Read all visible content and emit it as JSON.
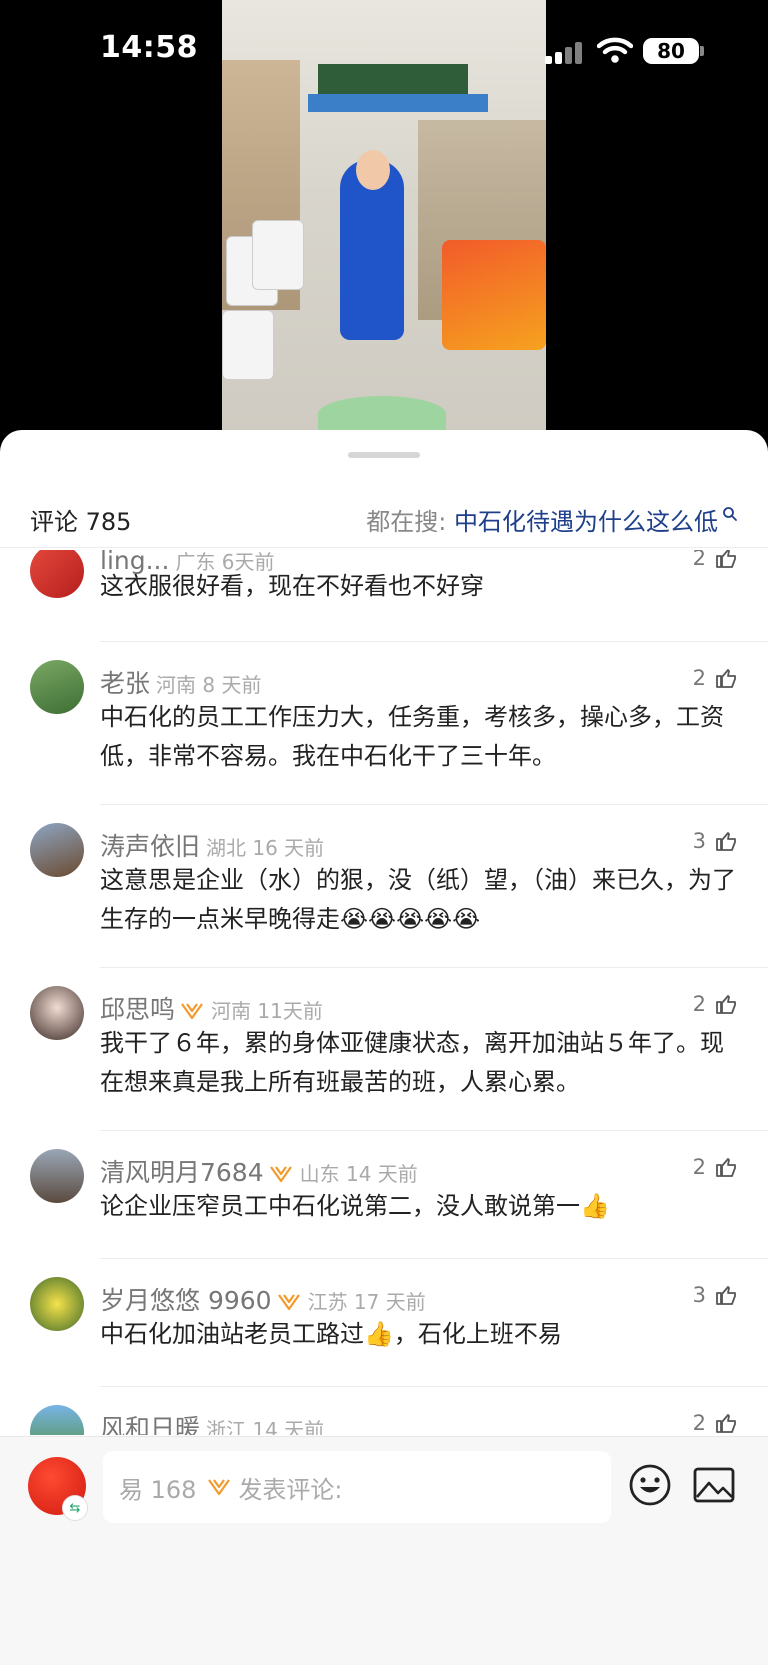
{
  "status_bar": {
    "time": "14:58",
    "battery": "80"
  },
  "header": {
    "comments_label": "评论 785",
    "search_prefix": "都在搜:",
    "search_keyword": "中石化待遇为什么这么低"
  },
  "comments": [
    {
      "name": "ling...",
      "meta": "广东 6天前",
      "likes": "2",
      "text": "这衣服很好看，现在不好看也不好穿"
    },
    {
      "name": "老张",
      "meta": "河南 8 天前",
      "likes": "2",
      "text": "中石化的员工工作压力大，任务重，考核多，操心多，工资低，非常不容易。我在中石化干了三十年。"
    },
    {
      "name": "涛声依旧",
      "meta": "湖北 16 天前",
      "likes": "3",
      "text": "这意思是企业（水）的狠，没（纸）望，（油）来已久，为了生存的一点米早晚得走😭😭😭😭😭"
    },
    {
      "name": "邱思鸣",
      "meta": "河南 11天前",
      "likes": "2",
      "text": "我干了６年，累的身体亚健康状态，离开加油站５年了。现在想来真是我上所有班最苦的班，人累心累。"
    },
    {
      "name": "清风明月7684",
      "meta": "山东 14 天前",
      "likes": "2",
      "text": "论企业压窄员工中石化说第二，没人敢说第一👍"
    },
    {
      "name": "岁月悠悠 9960",
      "meta": "江苏 17 天前",
      "likes": "3",
      "text": "中石化加油站老员工路过👍，石化上班不易"
    },
    {
      "name": "风和日暖",
      "meta": "浙江 14 天前",
      "likes": "2",
      "text": ""
    }
  ],
  "input_bar": {
    "user": "易 168",
    "placeholder": "发表评论:"
  },
  "colors": {
    "keyword": "#1f3f8a",
    "vip": "#f39a2b",
    "brand_red": "#d01a10"
  }
}
